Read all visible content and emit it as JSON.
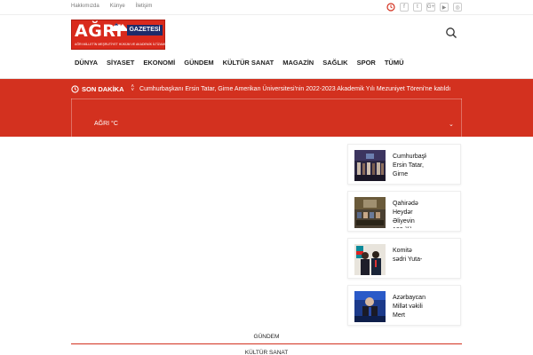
{
  "topbar": {
    "links": [
      "Hakkımızda",
      "Künye",
      "İletişim"
    ],
    "social": [
      "f",
      "t",
      "G+",
      "▶",
      "◎"
    ]
  },
  "logo": {
    "word": "AĞRI",
    "badge": "GAZETESİ",
    "tagline": "AĞRI MİLLETİN MEŞRUTİYET HÜKÜM VE AKADEMİK İLTİZAMI"
  },
  "nav": [
    "DÜNYA",
    "SİYASET",
    "EKONOMİ",
    "GÜNDEM",
    "KÜLTÜR SANAT",
    "MAGAZİN",
    "SAĞLIK",
    "SPOR",
    "TÜMÜ"
  ],
  "breaking": {
    "label": "SON DAKİKA",
    "text": "Cumhurbaşkanı Ersin Tatar, Girne Amerikan Üniversitesi'nin 2022-2023 Akademik Yılı Mezuniyet Töreni'ne katıldı"
  },
  "weather": {
    "label": "AĞRI °C",
    "caret": "⌄"
  },
  "cards": [
    {
      "title": "Cumhurbaşkanı Ersin Tatar, Girne"
    },
    {
      "title": "Qahirədə Heydər Əliyevin 100 illik"
    },
    {
      "title": "Komitə sədri Yuta-"
    },
    {
      "title": "Azərbaycan Millət vəkili Mert"
    }
  ],
  "tabs": [
    "GÜNDEM",
    "KÜLTÜR SANAT"
  ],
  "colors": {
    "brand": "#d3311f",
    "navy": "#1d2b69"
  }
}
